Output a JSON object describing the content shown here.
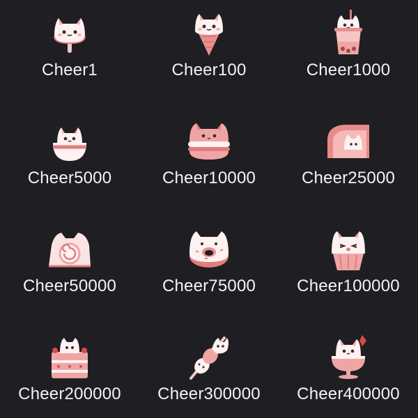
{
  "palette": {
    "background": "#1f1f23",
    "text": "#f4f4f4",
    "pink_light": "#fbe3e3",
    "pink": "#f3a7a7",
    "pink_dark": "#e07e7e",
    "cream": "#fff3ee",
    "red": "#d94a4a"
  },
  "cheers": [
    {
      "label": "Cheer1",
      "icon": "cat-popsicle-icon"
    },
    {
      "label": "Cheer100",
      "icon": "cat-ice-cream-cone-icon"
    },
    {
      "label": "Cheer1000",
      "icon": "cat-boba-tea-icon"
    },
    {
      "label": "Cheer5000",
      "icon": "cat-pudding-cup-icon"
    },
    {
      "label": "Cheer10000",
      "icon": "cat-macaron-icon"
    },
    {
      "label": "Cheer25000",
      "icon": "mochi-slice-icon"
    },
    {
      "label": "Cheer50000",
      "icon": "cat-swiss-roll-icon"
    },
    {
      "label": "Cheer75000",
      "icon": "cat-donut-icon"
    },
    {
      "label": "Cheer100000",
      "icon": "cat-cupcake-icon"
    },
    {
      "label": "Cheer200000",
      "icon": "cat-strawberry-cake-icon"
    },
    {
      "label": "Cheer300000",
      "icon": "cat-dango-skewer-icon"
    },
    {
      "label": "Cheer400000",
      "icon": "cat-parfait-sundae-icon"
    }
  ]
}
